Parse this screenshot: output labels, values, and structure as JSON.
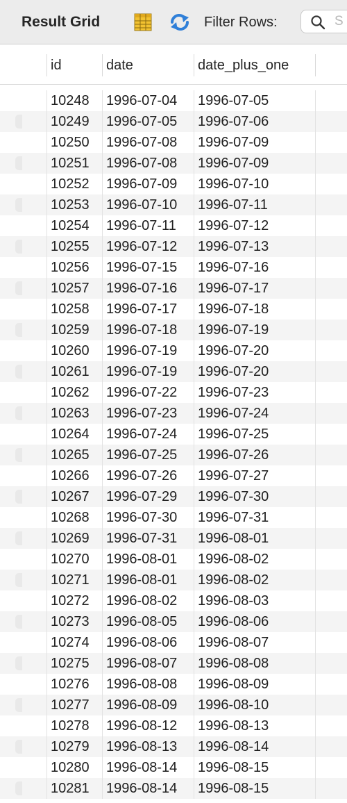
{
  "toolbar": {
    "title": "Result Grid",
    "filter_label": "Filter Rows:",
    "search_placeholder": "S",
    "icons": [
      "grid-layout-icon",
      "refresh-icon",
      "search-icon"
    ]
  },
  "columns": [
    "id",
    "date",
    "date_plus_one"
  ],
  "rows": [
    [
      "10248",
      "1996-07-04",
      "1996-07-05"
    ],
    [
      "10249",
      "1996-07-05",
      "1996-07-06"
    ],
    [
      "10250",
      "1996-07-08",
      "1996-07-09"
    ],
    [
      "10251",
      "1996-07-08",
      "1996-07-09"
    ],
    [
      "10252",
      "1996-07-09",
      "1996-07-10"
    ],
    [
      "10253",
      "1996-07-10",
      "1996-07-11"
    ],
    [
      "10254",
      "1996-07-11",
      "1996-07-12"
    ],
    [
      "10255",
      "1996-07-12",
      "1996-07-13"
    ],
    [
      "10256",
      "1996-07-15",
      "1996-07-16"
    ],
    [
      "10257",
      "1996-07-16",
      "1996-07-17"
    ],
    [
      "10258",
      "1996-07-17",
      "1996-07-18"
    ],
    [
      "10259",
      "1996-07-18",
      "1996-07-19"
    ],
    [
      "10260",
      "1996-07-19",
      "1996-07-20"
    ],
    [
      "10261",
      "1996-07-19",
      "1996-07-20"
    ],
    [
      "10262",
      "1996-07-22",
      "1996-07-23"
    ],
    [
      "10263",
      "1996-07-23",
      "1996-07-24"
    ],
    [
      "10264",
      "1996-07-24",
      "1996-07-25"
    ],
    [
      "10265",
      "1996-07-25",
      "1996-07-26"
    ],
    [
      "10266",
      "1996-07-26",
      "1996-07-27"
    ],
    [
      "10267",
      "1996-07-29",
      "1996-07-30"
    ],
    [
      "10268",
      "1996-07-30",
      "1996-07-31"
    ],
    [
      "10269",
      "1996-07-31",
      "1996-08-01"
    ],
    [
      "10270",
      "1996-08-01",
      "1996-08-02"
    ],
    [
      "10271",
      "1996-08-01",
      "1996-08-02"
    ],
    [
      "10272",
      "1996-08-02",
      "1996-08-03"
    ],
    [
      "10273",
      "1996-08-05",
      "1996-08-06"
    ],
    [
      "10274",
      "1996-08-06",
      "1996-08-07"
    ],
    [
      "10275",
      "1996-08-07",
      "1996-08-08"
    ],
    [
      "10276",
      "1996-08-08",
      "1996-08-09"
    ],
    [
      "10277",
      "1996-08-09",
      "1996-08-10"
    ],
    [
      "10278",
      "1996-08-12",
      "1996-08-13"
    ],
    [
      "10279",
      "1996-08-13",
      "1996-08-14"
    ],
    [
      "10280",
      "1996-08-14",
      "1996-08-15"
    ],
    [
      "10281",
      "1996-08-14",
      "1996-08-15"
    ]
  ],
  "colors": {
    "toolbar_bg": "#ececec",
    "alt_row_bg": "#f4f4f4",
    "grid_icon_yellow": "#f2c230",
    "refresh_icon_blue": "#2f7fd8"
  }
}
